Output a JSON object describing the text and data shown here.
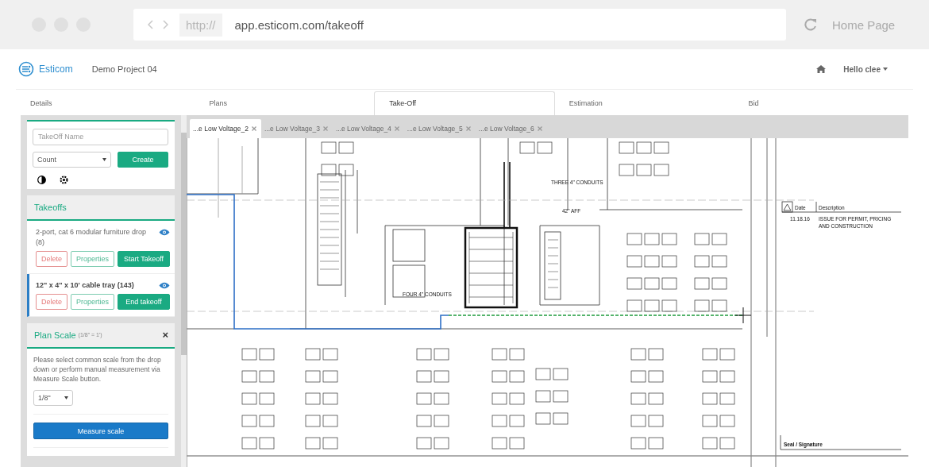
{
  "browser": {
    "url_prefix": "http://",
    "url": "app.esticom.com/takeoff",
    "home_label": "Home Page"
  },
  "header": {
    "brand": "Esticom",
    "project": "Demo Project 04",
    "user": "Hello clee"
  },
  "nav_tabs": [
    {
      "label": "Details",
      "selected": false
    },
    {
      "label": "Plans",
      "selected": false
    },
    {
      "label": "Take-Off",
      "selected": true
    },
    {
      "label": "Estimation",
      "selected": false
    },
    {
      "label": "Bid",
      "selected": false
    }
  ],
  "create_panel": {
    "name_placeholder": "TakeOff Name",
    "type_value": "Count",
    "create_label": "Create"
  },
  "takeoffs": {
    "title": "Takeoffs",
    "items": [
      {
        "name": "2-port, cat 6 modular furniture drop (8)",
        "active": false,
        "delete_label": "Delete",
        "properties_label": "Properties",
        "action_label": "Start Takeoff"
      },
      {
        "name": "12\" x 4\" x 10' cable tray (143)",
        "active": true,
        "delete_label": "Delete",
        "properties_label": "Properties",
        "action_label": "End takeoff"
      }
    ]
  },
  "plan_scale": {
    "title": "Plan Scale",
    "note": "(1/8\" = 1')",
    "close": "×",
    "description": "Please select common scale from the drop down or perform manual measurement via Measure Scale button.",
    "scale_value": "1/8\"",
    "measure_label": "Measure scale"
  },
  "sheet_tabs": [
    {
      "label": "...e Low Voltage_2",
      "selected": true
    },
    {
      "label": "...e Low Voltage_3",
      "selected": false
    },
    {
      "label": "...e Low Voltage_4",
      "selected": false
    },
    {
      "label": "...e Low Voltage_5",
      "selected": false
    },
    {
      "label": "...e Low Voltage_6",
      "selected": false
    }
  ],
  "plan": {
    "callouts": [
      "THREE 4\" CONDUITS",
      "42\" AFF",
      "FOUR 4\" CONDUITS"
    ],
    "revision": {
      "date_header": "Date",
      "description_header": "Description",
      "date": "11.18.16",
      "description_lines": [
        "ISSUE FOR PERMIT, PRICING",
        "AND CONSTRUCTION"
      ]
    },
    "seal_label": "Seal / Signature"
  }
}
